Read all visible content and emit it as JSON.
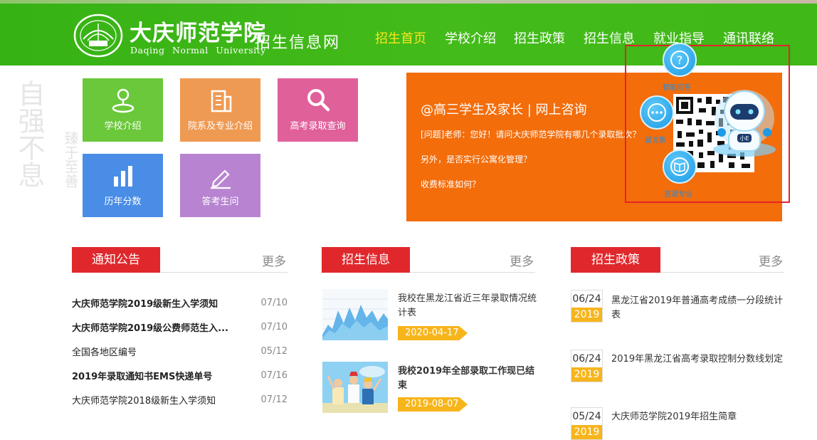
{
  "header": {
    "school_name": "大庆师范学院",
    "site_name": "招生信息网",
    "school_name_en": "Daqing Normal University",
    "nav": [
      "招生首页",
      "学校介绍",
      "招生政策",
      "招生信息",
      "就业指导",
      "通讯联络"
    ],
    "active_nav": "招生首页"
  },
  "colors": {
    "header_green": "#3fb818",
    "nav_active": "#f8e71c",
    "consult_orange": "#f36d0b",
    "section_red": "#e0282c",
    "date_yellow": "#f7b51c"
  },
  "tiles": [
    {
      "label": "学校介绍",
      "icon": "location-pin-icon",
      "color": "#6ac83a"
    },
    {
      "label": "院系及专业介绍",
      "icon": "building-icon",
      "color": "#ef9a52"
    },
    {
      "label": "高考录取查询",
      "icon": "search-icon",
      "color": "#e0609a"
    },
    {
      "label": "历年分数",
      "icon": "bar-chart-icon",
      "color": "#4a8de6"
    },
    {
      "label": "答考生问",
      "icon": "edit-pen-icon",
      "color": "#b884d1"
    }
  ],
  "consult": {
    "title": "@高三学生及家长 | 网上咨询",
    "questions": [
      "[问题]老师：您好！请问大庆师范学院有哪几个录取批次？",
      "另外，是否实行公寓化管理？",
      "收费标准如何？"
    ]
  },
  "widget": {
    "btn_qa": "智能问答",
    "btn_msg": "留言板",
    "btn_major": "直通专业",
    "robot_badge": "小E"
  },
  "sections": {
    "notice": {
      "title": "通知公告",
      "more": "更多",
      "items": [
        {
          "title": "大庆师范学院2019级新生入学须知",
          "date": "07/10",
          "bold": true
        },
        {
          "title": "大庆师范学院2019级公费师范生入...",
          "date": "07/10",
          "bold": true
        },
        {
          "title": "全国各地区编号",
          "date": "05/12",
          "bold": false
        },
        {
          "title": "2019年录取通知书EMS快递单号",
          "date": "07/16",
          "bold": true
        },
        {
          "title": "大庆师范学院2018级新生入学须知",
          "date": "07/12",
          "bold": false
        }
      ]
    },
    "info": {
      "title": "招生信息",
      "more": "更多",
      "items": [
        {
          "title": "我校在黑龙江省近三年录取情况统计表",
          "date": "2020-04-17",
          "bold": false,
          "thumb": "chart-thumbnail"
        },
        {
          "title": "我校2019年全部录取工作现已结束",
          "date": "2019-08-07",
          "bold": true,
          "thumb": "students-photo"
        }
      ]
    },
    "policy": {
      "title": "招生政策",
      "more": "更多",
      "items": [
        {
          "md": "06/24",
          "year": "2019",
          "title": "黑龙江省2019年普通高考成绩一分段统计表"
        },
        {
          "md": "06/24",
          "year": "2019",
          "title": "2019年黑龙江省高考录取控制分数线划定"
        },
        {
          "md": "05/24",
          "year": "2019",
          "title": "大庆师范学院2019年招生简章"
        }
      ]
    }
  },
  "background_text": [
    "自强不息",
    "臻于至善"
  ]
}
